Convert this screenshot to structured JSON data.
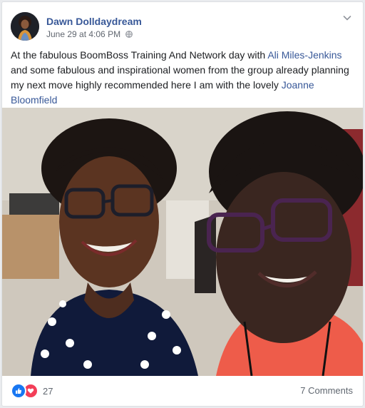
{
  "post": {
    "author": "Dawn Dolldaydream",
    "timestamp": "June 29 at 4:06 PM",
    "privacy_icon": "globe-icon",
    "options_icon": "chevron-down-icon",
    "text_parts": {
      "t1": "At the fabulous BoomBoss Training And Network day with ",
      "link1": "Ali Miles-Jenkins",
      "t2": " and some fabulous and inspirational women from the group already planning my next move highly recommended here I am with the lovely ",
      "link2": "Joanne Bloomfield"
    },
    "photo_icon": "selfie-photo"
  },
  "reactions": {
    "icons": [
      "like-icon",
      "love-icon"
    ],
    "count": "27"
  },
  "comments": {
    "label": "7 Comments"
  },
  "colors": {
    "link": "#385898",
    "like": "#1877f2",
    "love": "#f33e58",
    "background": "#e9ebee"
  }
}
